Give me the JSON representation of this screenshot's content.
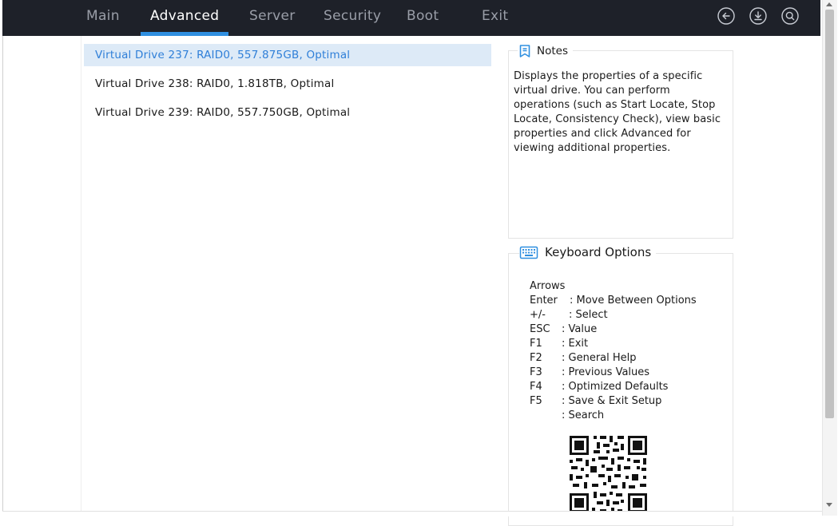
{
  "nav": {
    "tabs": [
      {
        "label": "Main"
      },
      {
        "label": "Advanced"
      },
      {
        "label": "Server"
      },
      {
        "label": "Security"
      },
      {
        "label": "Boot"
      },
      {
        "label": "Exit"
      }
    ],
    "active_tab": "Advanced",
    "icons": [
      "back-icon",
      "download-icon",
      "search-icon"
    ]
  },
  "drives": [
    {
      "label": "Virtual Drive 237: RAID0, 557.875GB, Optimal",
      "selected": true
    },
    {
      "label": "Virtual Drive 238: RAID0, 1.818TB, Optimal",
      "selected": false
    },
    {
      "label": "Virtual Drive 239: RAID0, 557.750GB, Optimal",
      "selected": false
    }
  ],
  "notes": {
    "title": "Notes",
    "text": "Displays the properties of a specific virtual drive. You can perform operations (such as Start Locate, Stop Locate, Consistency Check), view basic properties and click Advanced for viewing additional properties."
  },
  "keyboard": {
    "title": "Keyboard Options",
    "rows": [
      {
        "key": "Arrows",
        "desc": ": Move Between Options"
      },
      {
        "key": "Enter",
        "desc": ": Select"
      },
      {
        "key": "+/-",
        "desc": ": Value"
      },
      {
        "key": "ESC",
        "desc": ": Exit"
      },
      {
        "key": "F1",
        "desc": ": General Help"
      },
      {
        "key": "F2",
        "desc": ": Previous Values"
      },
      {
        "key": "F3",
        "desc": ": Optimized Defaults"
      },
      {
        "key": "F4",
        "desc": ": Save & Exit Setup"
      },
      {
        "key": "F5",
        "desc": ": Search"
      }
    ]
  },
  "colors": {
    "nav_bg": "#1e2129",
    "accent": "#2f8fe0",
    "selected_bg": "#ddeaf7",
    "selected_text": "#2f7fd8"
  }
}
